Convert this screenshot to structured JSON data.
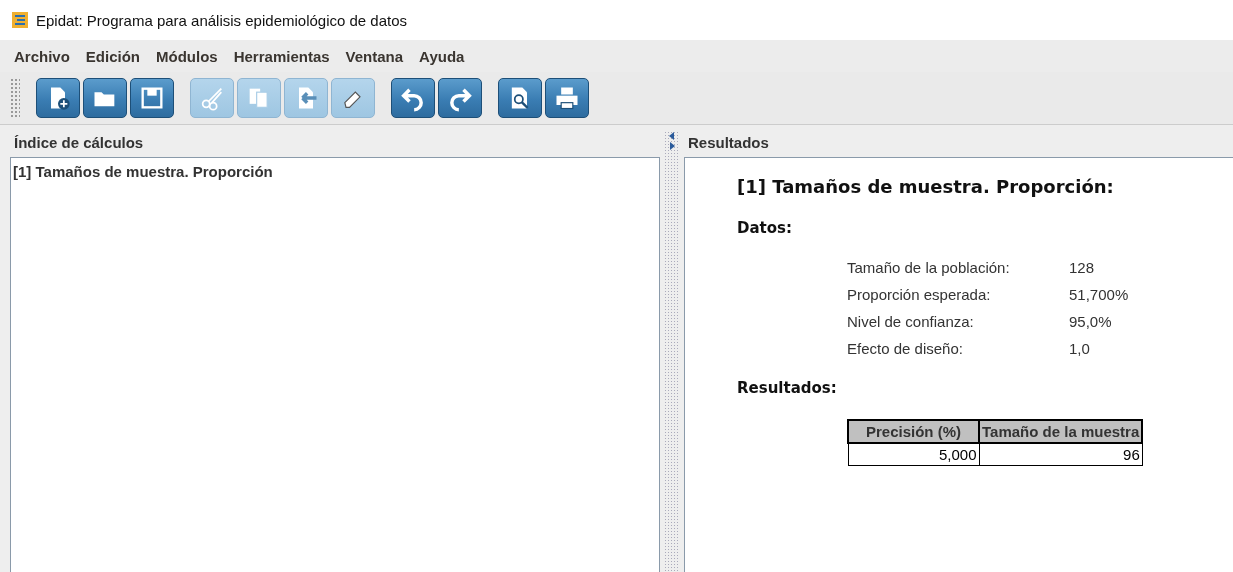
{
  "window": {
    "title": "Epidat: Programa para análisis epidemiológico de datos"
  },
  "menu": [
    "Archivo",
    "Edición",
    "Módulos",
    "Herramientas",
    "Ventana",
    "Ayuda"
  ],
  "toolbar": [
    [
      {
        "kind": "new",
        "disabled": false
      },
      {
        "kind": "open",
        "disabled": false
      },
      {
        "kind": "save",
        "disabled": false
      }
    ],
    [
      {
        "kind": "cut",
        "disabled": true
      },
      {
        "kind": "copy",
        "disabled": true
      },
      {
        "kind": "paste",
        "disabled": true
      },
      {
        "kind": "erase",
        "disabled": true
      }
    ],
    [
      {
        "kind": "undo",
        "disabled": false
      },
      {
        "kind": "redo",
        "disabled": false
      }
    ],
    [
      {
        "kind": "preview",
        "disabled": false
      },
      {
        "kind": "print",
        "disabled": false
      }
    ]
  ],
  "index_panel": {
    "title": "Índice de cálculos",
    "items": [
      {
        "label": "[1] Tamaños de muestra. Proporción",
        "selected": false
      }
    ]
  },
  "results_panel": {
    "title": "Resultados",
    "heading": "[1] Tamaños de muestra. Proporción:",
    "data_title": "Datos:",
    "data": [
      {
        "label": "Tamaño de la población:",
        "value": "128"
      },
      {
        "label": "Proporción esperada:",
        "value": "51,700%"
      },
      {
        "label": "Nivel de confianza:",
        "value": "95,0%"
      },
      {
        "label": "Efecto de diseño:",
        "value": "1,0"
      }
    ],
    "results_title": "Resultados:",
    "table": {
      "columns": [
        "Precisión (%)",
        "Tamaño de la muestra"
      ],
      "rows": [
        [
          "5,000",
          "96"
        ]
      ]
    }
  }
}
